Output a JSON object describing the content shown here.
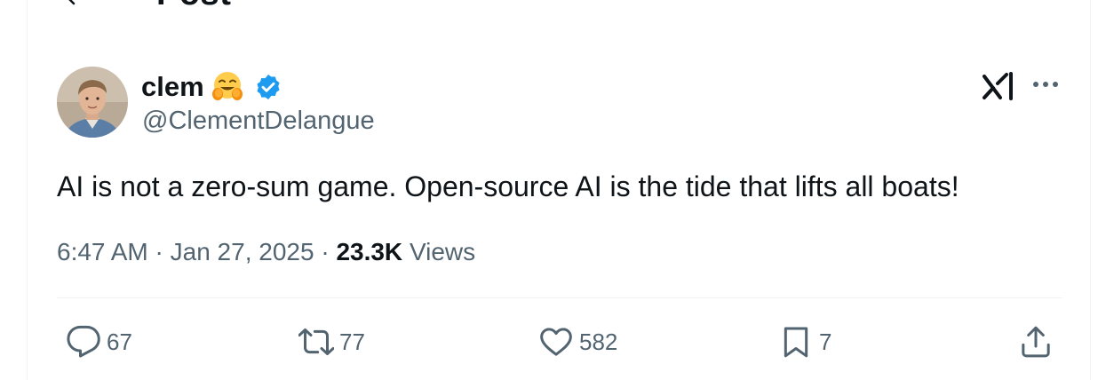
{
  "header": {
    "title": "Post"
  },
  "author": {
    "display_name": "clem",
    "emoji": "hugging-face-emoji",
    "verified": true,
    "handle": "@ClementDelangue"
  },
  "post": {
    "text": "AI is not a zero-sum game. Open-source AI is the tide that lifts all boats!",
    "time": "6:47 AM",
    "date": "Jan 27, 2025",
    "views_count": "23.3K",
    "views_label": "Views"
  },
  "actions": {
    "replies": "67",
    "reposts": "77",
    "likes": "582",
    "bookmarks": "7"
  },
  "icons": {
    "back": "arrow-left-icon",
    "verified": "verified-badge-icon",
    "grok": "grok-icon",
    "more": "more-horizontal-icon",
    "reply": "reply-icon",
    "repost": "repost-icon",
    "like": "heart-icon",
    "bookmark": "bookmark-icon",
    "share": "share-icon"
  },
  "colors": {
    "text_primary": "#0f1419",
    "text_secondary": "#536471",
    "verified_blue": "#1d9bf0",
    "divider": "#eff3f4"
  }
}
